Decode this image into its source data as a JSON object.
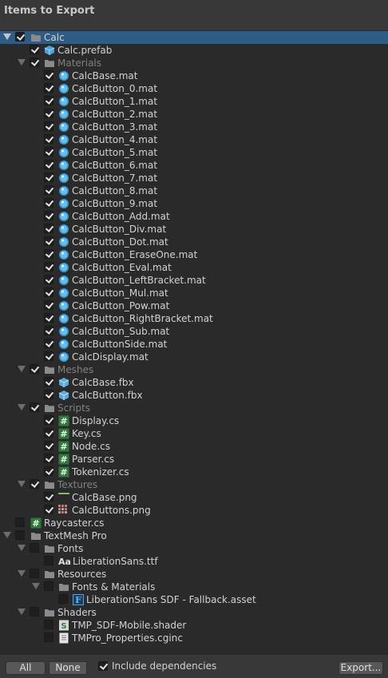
{
  "window": {
    "title": "Items to Export"
  },
  "tree": [
    {
      "label": "Calc",
      "kind": "folder-root",
      "depth": 0,
      "checked": true,
      "selected": true,
      "arrow": true,
      "icon": "folder-icon"
    },
    {
      "label": "Calc.prefab",
      "kind": "file",
      "depth": 1,
      "checked": true,
      "arrow": false,
      "icon": "prefab-icon"
    },
    {
      "label": "Materials",
      "kind": "folder",
      "depth": 1,
      "checked": true,
      "arrow": true,
      "icon": "folder-icon"
    },
    {
      "label": "CalcBase.mat",
      "kind": "file",
      "depth": 2,
      "checked": true,
      "arrow": false,
      "icon": "material-icon"
    },
    {
      "label": "CalcButton_0.mat",
      "kind": "file",
      "depth": 2,
      "checked": true,
      "arrow": false,
      "icon": "material-icon"
    },
    {
      "label": "CalcButton_1.mat",
      "kind": "file",
      "depth": 2,
      "checked": true,
      "arrow": false,
      "icon": "material-icon"
    },
    {
      "label": "CalcButton_2.mat",
      "kind": "file",
      "depth": 2,
      "checked": true,
      "arrow": false,
      "icon": "material-icon"
    },
    {
      "label": "CalcButton_3.mat",
      "kind": "file",
      "depth": 2,
      "checked": true,
      "arrow": false,
      "icon": "material-icon"
    },
    {
      "label": "CalcButton_4.mat",
      "kind": "file",
      "depth": 2,
      "checked": true,
      "arrow": false,
      "icon": "material-icon"
    },
    {
      "label": "CalcButton_5.mat",
      "kind": "file",
      "depth": 2,
      "checked": true,
      "arrow": false,
      "icon": "material-icon"
    },
    {
      "label": "CalcButton_6.mat",
      "kind": "file",
      "depth": 2,
      "checked": true,
      "arrow": false,
      "icon": "material-icon"
    },
    {
      "label": "CalcButton_7.mat",
      "kind": "file",
      "depth": 2,
      "checked": true,
      "arrow": false,
      "icon": "material-icon"
    },
    {
      "label": "CalcButton_8.mat",
      "kind": "file",
      "depth": 2,
      "checked": true,
      "arrow": false,
      "icon": "material-icon"
    },
    {
      "label": "CalcButton_9.mat",
      "kind": "file",
      "depth": 2,
      "checked": true,
      "arrow": false,
      "icon": "material-icon"
    },
    {
      "label": "CalcButton_Add.mat",
      "kind": "file",
      "depth": 2,
      "checked": true,
      "arrow": false,
      "icon": "material-icon"
    },
    {
      "label": "CalcButton_Div.mat",
      "kind": "file",
      "depth": 2,
      "checked": true,
      "arrow": false,
      "icon": "material-icon"
    },
    {
      "label": "CalcButton_Dot.mat",
      "kind": "file",
      "depth": 2,
      "checked": true,
      "arrow": false,
      "icon": "material-icon"
    },
    {
      "label": "CalcButton_EraseOne.mat",
      "kind": "file",
      "depth": 2,
      "checked": true,
      "arrow": false,
      "icon": "material-icon"
    },
    {
      "label": "CalcButton_Eval.mat",
      "kind": "file",
      "depth": 2,
      "checked": true,
      "arrow": false,
      "icon": "material-icon"
    },
    {
      "label": "CalcButton_LeftBracket.mat",
      "kind": "file",
      "depth": 2,
      "checked": true,
      "arrow": false,
      "icon": "material-icon"
    },
    {
      "label": "CalcButton_Mul.mat",
      "kind": "file",
      "depth": 2,
      "checked": true,
      "arrow": false,
      "icon": "material-icon"
    },
    {
      "label": "CalcButton_Pow.mat",
      "kind": "file",
      "depth": 2,
      "checked": true,
      "arrow": false,
      "icon": "material-icon"
    },
    {
      "label": "CalcButton_RightBracket.mat",
      "kind": "file",
      "depth": 2,
      "checked": true,
      "arrow": false,
      "icon": "material-icon"
    },
    {
      "label": "CalcButton_Sub.mat",
      "kind": "file",
      "depth": 2,
      "checked": true,
      "arrow": false,
      "icon": "material-icon"
    },
    {
      "label": "CalcButtonSide.mat",
      "kind": "file",
      "depth": 2,
      "checked": true,
      "arrow": false,
      "icon": "material-icon"
    },
    {
      "label": "CalcDisplay.mat",
      "kind": "file",
      "depth": 2,
      "checked": true,
      "arrow": false,
      "icon": "material-icon"
    },
    {
      "label": "Meshes",
      "kind": "folder",
      "depth": 1,
      "checked": true,
      "arrow": true,
      "icon": "folder-icon"
    },
    {
      "label": "CalcBase.fbx",
      "kind": "file",
      "depth": 2,
      "checked": true,
      "arrow": false,
      "icon": "mesh-icon"
    },
    {
      "label": "CalcButton.fbx",
      "kind": "file",
      "depth": 2,
      "checked": true,
      "arrow": false,
      "icon": "mesh-icon"
    },
    {
      "label": "Scripts",
      "kind": "folder",
      "depth": 1,
      "checked": true,
      "arrow": true,
      "icon": "folder-icon"
    },
    {
      "label": "Display.cs",
      "kind": "file",
      "depth": 2,
      "checked": true,
      "arrow": false,
      "icon": "script-icon"
    },
    {
      "label": "Key.cs",
      "kind": "file",
      "depth": 2,
      "checked": true,
      "arrow": false,
      "icon": "script-icon"
    },
    {
      "label": "Node.cs",
      "kind": "file",
      "depth": 2,
      "checked": true,
      "arrow": false,
      "icon": "script-icon"
    },
    {
      "label": "Parser.cs",
      "kind": "file",
      "depth": 2,
      "checked": true,
      "arrow": false,
      "icon": "script-icon"
    },
    {
      "label": "Tokenizer.cs",
      "kind": "file",
      "depth": 2,
      "checked": true,
      "arrow": false,
      "icon": "script-icon"
    },
    {
      "label": "Textures",
      "kind": "folder",
      "depth": 1,
      "checked": true,
      "arrow": true,
      "icon": "folder-icon"
    },
    {
      "label": "CalcBase.png",
      "kind": "file",
      "depth": 2,
      "checked": true,
      "arrow": false,
      "icon": "texture-flat-icon"
    },
    {
      "label": "CalcButtons.png",
      "kind": "file",
      "depth": 2,
      "checked": true,
      "arrow": false,
      "icon": "texture-grid-icon"
    },
    {
      "label": "Raycaster.cs",
      "kind": "file",
      "depth": 0,
      "checked": false,
      "arrow": false,
      "icon": "script-icon"
    },
    {
      "label": "TextMesh Pro",
      "kind": "folder",
      "depth": 0,
      "checked": false,
      "arrow": true,
      "icon": "folder-icon"
    },
    {
      "label": "Fonts",
      "kind": "folder",
      "depth": 1,
      "checked": false,
      "arrow": true,
      "icon": "folder-icon"
    },
    {
      "label": "LiberationSans.ttf",
      "kind": "file",
      "depth": 2,
      "checked": false,
      "arrow": false,
      "icon": "font-icon"
    },
    {
      "label": "Resources",
      "kind": "folder",
      "depth": 1,
      "checked": false,
      "arrow": true,
      "icon": "folder-icon"
    },
    {
      "label": "Fonts & Materials",
      "kind": "folder",
      "depth": 2,
      "checked": false,
      "arrow": true,
      "icon": "folder-icon"
    },
    {
      "label": "LiberationSans SDF - Fallback.asset",
      "kind": "file",
      "depth": 3,
      "checked": false,
      "arrow": false,
      "icon": "font-asset-icon"
    },
    {
      "label": "Shaders",
      "kind": "folder",
      "depth": 1,
      "checked": false,
      "arrow": true,
      "icon": "folder-icon"
    },
    {
      "label": "TMP_SDF-Mobile.shader",
      "kind": "file",
      "depth": 2,
      "checked": false,
      "arrow": false,
      "icon": "shader-icon"
    },
    {
      "label": "TMPro_Properties.cginc",
      "kind": "file",
      "depth": 2,
      "checked": false,
      "arrow": false,
      "icon": "text-file-icon"
    }
  ],
  "footer": {
    "all_label": "All",
    "none_label": "None",
    "include_dependencies_label": "Include dependencies",
    "include_dependencies_checked": true,
    "export_label": "Export..."
  },
  "colors": {
    "selection": "#2c5d87",
    "tree_background": "#2a2a2a",
    "window_background": "#383838"
  }
}
